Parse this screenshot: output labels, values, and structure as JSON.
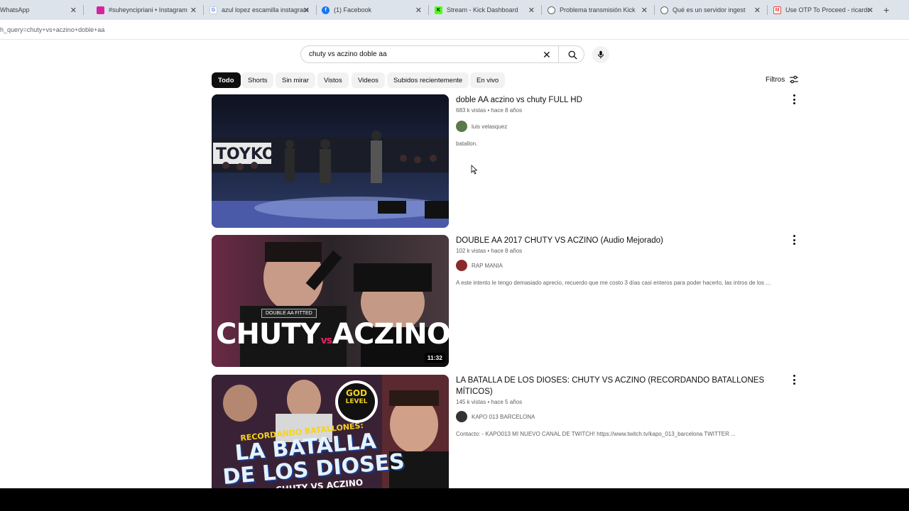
{
  "tabs": [
    {
      "label": "WhatsApp",
      "icon": "whatsapp-icon",
      "color": "#25d366"
    },
    {
      "label": "#suheyncipriani • Instagram",
      "icon": "instagram-icon",
      "color": "#d6249f"
    },
    {
      "label": "azul lopez escamilla instagram",
      "icon": "google-icon",
      "color": "#4285f4"
    },
    {
      "label": "(1) Facebook",
      "icon": "facebook-icon",
      "color": "#1877f2"
    },
    {
      "label": "Stream - Kick Dashboard",
      "icon": "kick-icon",
      "color": "#53fc18"
    },
    {
      "label": "Problema transmisión Kick",
      "icon": "chatgpt-icon",
      "color": "#5f6368"
    },
    {
      "label": "Qué es un servidor ingest",
      "icon": "chatgpt-icon",
      "color": "#5f6368"
    },
    {
      "label": "Use OTP To Proceed - ricardom",
      "icon": "gmail-icon",
      "color": "#ea4335"
    }
  ],
  "url": "h_query=chuty+vs+aczino+doble+aa",
  "search": {
    "query": "chuty vs aczino doble aa"
  },
  "chips": [
    "Todo",
    "Shorts",
    "Sin mirar",
    "Vistos",
    "Videos",
    "Subidos recientemente",
    "En vivo"
  ],
  "filters_label": "Filtros",
  "results": [
    {
      "title": "doble AA aczino vs chuty FULL HD",
      "meta": "683 k vistas • hace 8 años",
      "channel": "luis velasquez",
      "description": "batallon.",
      "duration": ""
    },
    {
      "title": "DOUBLE AA 2017 CHUTY VS ACZINO (Audio Mejorado)",
      "meta": "102 k vistas • hace 8 años",
      "channel": "RAP MANIA",
      "description": "A este intento le tengo demasiado aprecio, recuerdo que me costo 3 días casi enteros para poder hacerlo, las intros de los ...",
      "duration": "11:32"
    },
    {
      "title": "LA BATALLA DE LOS DIOSES: CHUTY VS ACZINO (RECORDANDO BATALLONES MÍTICOS)",
      "meta": "145 k vistas • hace 5 años",
      "channel": "KAPO 013 BARCELONA",
      "description": "Contacto: - KAPO013 MI NUEVO CANAL DE TWITCH! https://www.twitch.tv/kapo_013_barcelona TWITTER ...",
      "duration": ""
    }
  ],
  "thumb_text": {
    "r1_banner": "TOYKO",
    "r2_badge": "DOUBLE AA FITTED",
    "r2_big": "CHUTY",
    "r2_vs": "vs",
    "r2_big2": "ACZINO",
    "r3_top": "RECORDANDO BATALLONES:",
    "r3_line1": "LA BATALLA",
    "r3_line2": "DE LOS DIOSES",
    "r3_badge1": "GOD",
    "r3_badge2": "LEVEL",
    "r3_bottom": "CHUTY VS ACZINO"
  }
}
